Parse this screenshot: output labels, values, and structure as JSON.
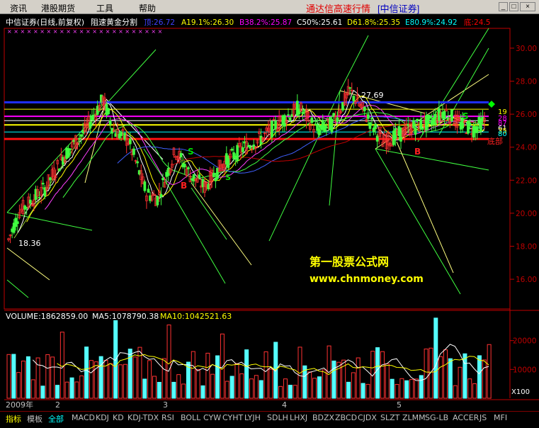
{
  "menu": {
    "items": [
      "资讯",
      "港股期货",
      "工具",
      "帮助"
    ],
    "title": "通达信高速行情",
    "broker": "[中信证券]"
  },
  "main_chart": {
    "header": "中信证券(日线,前复权)",
    "formula": "阻速黄金分割",
    "levels": [
      {
        "label": "顶:26.72",
        "color": "#4040ff"
      },
      {
        "label": "A19.1%:26.30",
        "color": "#ffff00"
      },
      {
        "label": "B38.2%:25.87",
        "color": "#ff00ff"
      },
      {
        "label": "C50%:25.61",
        "color": "#ffffff"
      },
      {
        "label": "D61.8%:25.35",
        "color": "#ffff00"
      },
      {
        "label": "E80.9%:24.92",
        "color": "#00ffff"
      },
      {
        "label": "底:24.5",
        "color": "#ff0000"
      }
    ],
    "y_ticks": [
      "30.00",
      "28.00",
      "26.00",
      "24.00",
      "22.00",
      "20.00",
      "18.00",
      "16.00"
    ],
    "y_range": [
      14.2,
      31.2
    ],
    "annotations": {
      "low": "18.36",
      "high": "27.69",
      "right_labels": [
        "19",
        "28",
        "87",
        "61",
        "35",
        "80",
        "底部"
      ],
      "signals": [
        {
          "text": "S",
          "color": "#00e000"
        },
        {
          "text": "B",
          "color": "#ff2020"
        },
        {
          "text": "S",
          "color": "#00e000"
        },
        {
          "text": "B",
          "color": "#ff2020"
        },
        {
          "text": "S",
          "color": "#00e000"
        }
      ]
    },
    "watermark": {
      "line1": "第一股票公式网",
      "line2": "www.chnmoney.com"
    }
  },
  "volume_chart": {
    "header": "VOLUME:1862859.00",
    "ma5": "MA5:1078790.38",
    "ma10": "MA10:1042521.63",
    "y_ticks": [
      "20000",
      "10000",
      "X100"
    ],
    "y_range": [
      0,
      30000
    ]
  },
  "time_axis": {
    "labels": [
      "2009年",
      "2",
      "3",
      "4",
      "5"
    ]
  },
  "tabs": [
    "指标",
    "模板",
    "全部",
    "MACD",
    "KDJ",
    "KD",
    "KDJ-TDX",
    "RSI",
    "BOLL",
    "CYW",
    "CYHT",
    "LYJH",
    "SDLH",
    "LHXJ",
    "BDZX",
    "ZBCD",
    "CJDX",
    "SLZT",
    "ZLMM",
    "SG-LB",
    "ACCER",
    "JS",
    "MFI"
  ],
  "active_tab": "全部",
  "colors": {
    "up": "#ff3232",
    "down": "#54ffff",
    "frame": "#c00000",
    "axis_text": "#c00000"
  }
}
